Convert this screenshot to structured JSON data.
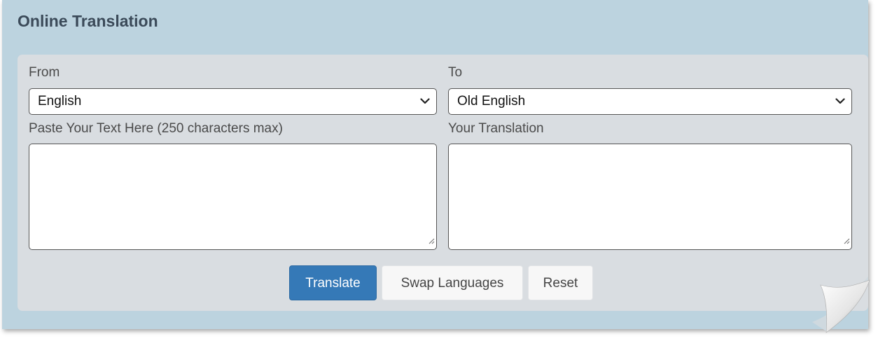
{
  "widget": {
    "title": "Online Translation"
  },
  "form": {
    "from_label": "From",
    "to_label": "To",
    "from_language": "English",
    "to_language": "Old English",
    "source_label": "Paste Your Text Here (250 characters max)",
    "target_label": "Your Translation",
    "source_text": "",
    "target_text": ""
  },
  "buttons": {
    "translate": "Translate",
    "swap": "Swap Languages",
    "reset": "Reset"
  },
  "icons": {
    "select_arrow": "chevron-down-icon",
    "resize_handle": "resize-grip-icon"
  },
  "colors": {
    "card_background": "#bcd3df",
    "panel_background": "#d9dde1",
    "primary_button": "#3579b7"
  }
}
